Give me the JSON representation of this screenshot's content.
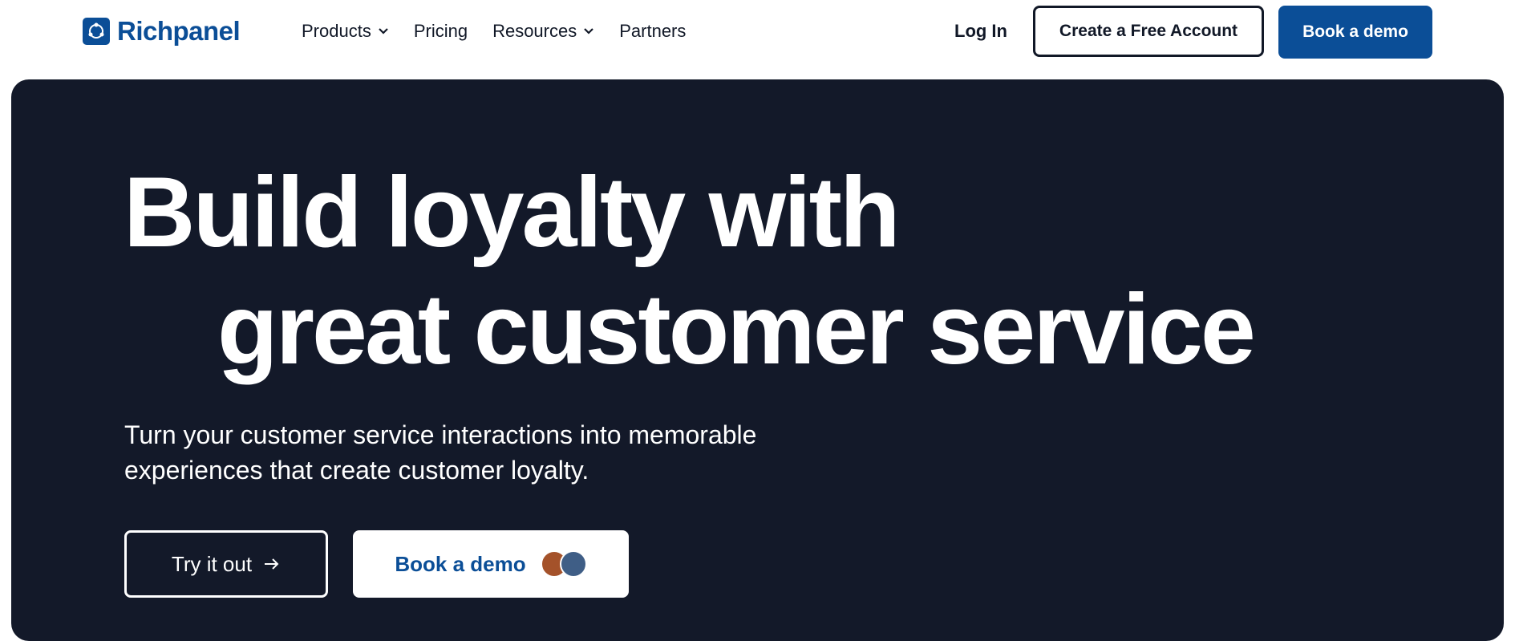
{
  "brand": {
    "name": "Richpanel",
    "color": "#0b4e97"
  },
  "nav": {
    "items": [
      {
        "label": "Products",
        "has_dropdown": true
      },
      {
        "label": "Pricing",
        "has_dropdown": false
      },
      {
        "label": "Resources",
        "has_dropdown": true
      },
      {
        "label": "Partners",
        "has_dropdown": false
      }
    ],
    "login_label": "Log In",
    "create_account_label": "Create a Free Account",
    "book_demo_label": "Book a demo"
  },
  "hero": {
    "headline_line1": "Build loyalty with",
    "headline_line2": "great customer service",
    "subtitle_line1": "Turn your customer service interactions into memorable",
    "subtitle_line2": "experiences that create customer loyalty.",
    "try_label": "Try it out",
    "try_icon": "arrow-right-icon",
    "book_demo_label": "Book a demo",
    "background_color": "#131929"
  }
}
